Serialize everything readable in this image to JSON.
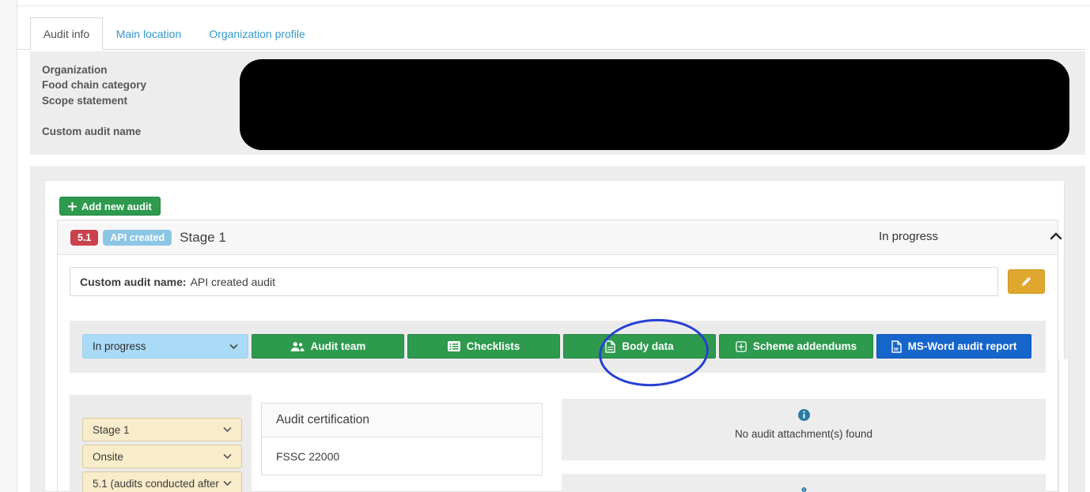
{
  "tabs": [
    {
      "label": "Audit info",
      "active": true
    },
    {
      "label": "Main location",
      "active": false
    },
    {
      "label": "Organization profile",
      "active": false
    }
  ],
  "summary": {
    "labels": [
      "Organization",
      "Food chain category",
      "Scope statement",
      "Custom audit name"
    ],
    "redacted_area": "black redaction box over values"
  },
  "audit_panel": {
    "add_button_label": "Add new audit",
    "header": {
      "version_badge": "5.1",
      "api_badge": "API created",
      "title": "Stage 1",
      "status": "In progress",
      "collapse_icon": "chevron-up-icon"
    },
    "custom_name": {
      "label": "Custom audit name:",
      "value": "API created audit",
      "edit_icon": "pencil-icon"
    },
    "toolbar": {
      "status_select": {
        "value": "In progress"
      },
      "buttons": [
        {
          "label": "Audit team",
          "icon": "users-icon"
        },
        {
          "label": "Checklists",
          "icon": "list-icon"
        },
        {
          "label": "Body data",
          "icon": "file-lines-icon"
        },
        {
          "label": "Scheme addendums",
          "icon": "plus-square-icon"
        },
        {
          "label": "MS-Word audit report",
          "icon": "word-file-icon"
        }
      ]
    },
    "detail_selects": [
      {
        "value": "Stage 1"
      },
      {
        "value": "Onsite"
      },
      {
        "value": "5.1 (audits conducted after"
      }
    ],
    "certification": {
      "title": "Audit certification",
      "value": "FSSC 22000"
    },
    "attachments": {
      "icon": "info-icon",
      "message": "No audit attachment(s) found"
    }
  },
  "annotation": {
    "shape": "ellipse",
    "target": "Body data button",
    "color": "#2740d4"
  },
  "colors": {
    "accent_green": "#2d9a4e",
    "word_blue": "#1565cb",
    "tab_link_blue": "#3598cb",
    "badge_red": "#c9424d",
    "badge_light_blue": "#8bc6e4",
    "status_select_blue": "#a9dbf6",
    "detail_select_cream": "#f8ecca",
    "edit_button_amber": "#dfa72e",
    "info_icon_teal": "#2a7ba6",
    "annotation_blue": "#2740d4",
    "section_gray": "#ededed"
  }
}
